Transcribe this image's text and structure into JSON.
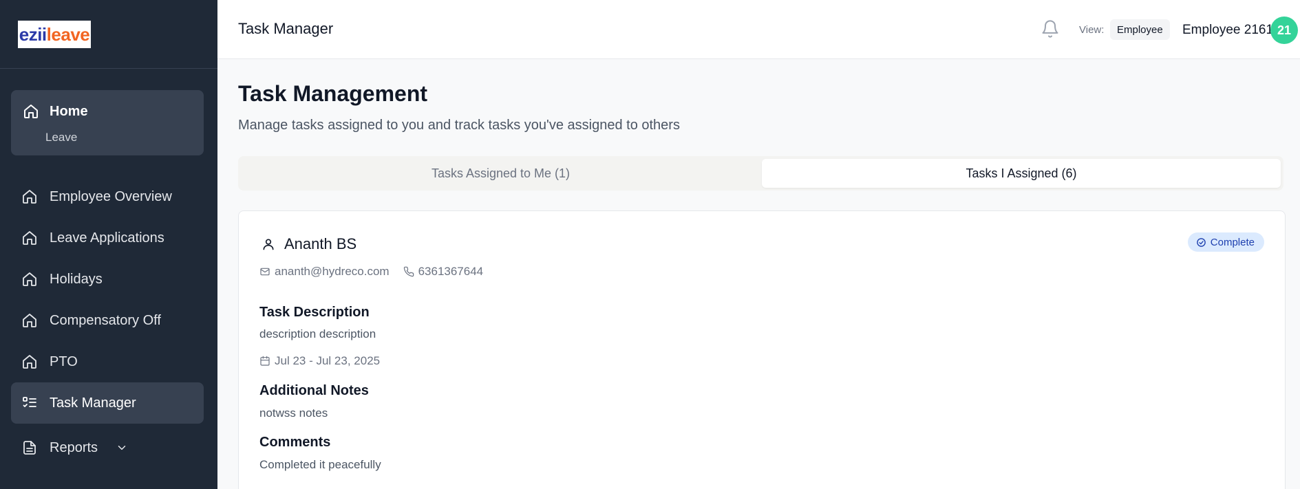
{
  "brand": {
    "part1": "ezii",
    "part2": "leave"
  },
  "sidebar": {
    "home": {
      "label": "Home",
      "sub": "Leave"
    },
    "items": [
      {
        "label": "Employee Overview",
        "icon": "home-icon"
      },
      {
        "label": "Leave Applications",
        "icon": "home-icon"
      },
      {
        "label": "Holidays",
        "icon": "home-icon"
      },
      {
        "label": "Compensatory Off",
        "icon": "home-icon"
      },
      {
        "label": "PTO",
        "icon": "home-icon"
      },
      {
        "label": "Task Manager",
        "icon": "task-list-icon",
        "active": true
      },
      {
        "label": "Reports",
        "icon": "document-icon",
        "expandable": true
      }
    ]
  },
  "header": {
    "title": "Task Manager",
    "view_label": "View:",
    "view_value": "Employee",
    "user_name": "Employee 2161",
    "avatar_text": "21"
  },
  "main": {
    "title": "Task Management",
    "subtitle": "Manage tasks assigned to you and track tasks you've assigned to others",
    "tabs": [
      {
        "label": "Tasks Assigned to Me (1)",
        "active": false
      },
      {
        "label": "Tasks I Assigned (6)",
        "active": true
      }
    ]
  },
  "task": {
    "assignee": "Ananth BS",
    "email": "ananth@hydreco.com",
    "phone": "6361367644",
    "status": "Complete",
    "description_heading": "Task Description",
    "description": "description description",
    "date_range": "Jul 23 - Jul 23, 2025",
    "notes_heading": "Additional Notes",
    "notes": "notwss notes",
    "comments_heading": "Comments",
    "comments": "Completed it peacefully"
  },
  "colors": {
    "sidebar_bg": "#1f2937",
    "sidebar_active": "#374151",
    "avatar": "#34d399",
    "badge_bg": "#dbeafe",
    "badge_text": "#1e40af",
    "logo_blue": "#2b3aa8",
    "logo_orange": "#f26522"
  }
}
